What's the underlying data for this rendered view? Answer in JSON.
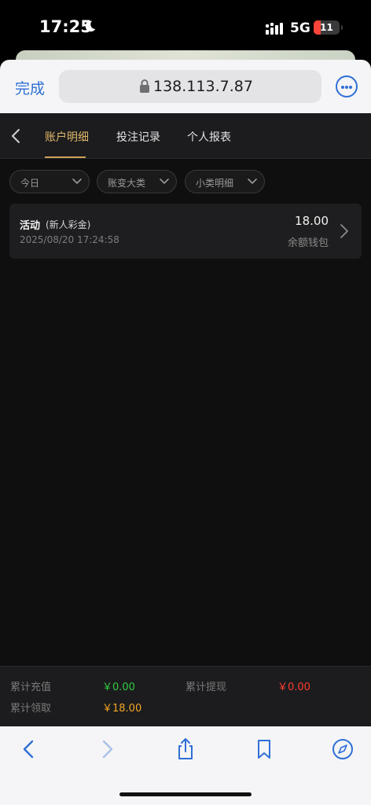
{
  "status_bar": {
    "time": "17:25",
    "network": "5G",
    "battery": "11",
    "icons": [
      "moon-icon",
      "signal-icon",
      "battery-icon"
    ]
  },
  "browser": {
    "done_label": "完成",
    "url": "138.113.7.87",
    "accent_color": "#2f6fd6"
  },
  "header": {
    "tabs": [
      {
        "label": "账户明细",
        "active": true
      },
      {
        "label": "投注记录",
        "active": false
      },
      {
        "label": "个人报表",
        "active": false
      }
    ],
    "accent_color": "#e0b86a"
  },
  "filters": [
    {
      "label": "今日"
    },
    {
      "label": "账变大类"
    },
    {
      "label": "小类明细"
    }
  ],
  "records": [
    {
      "title": "活动",
      "subtitle": "(新人彩金)",
      "time": "2025/08/20 17:24:58",
      "amount": "18.00",
      "wallet": "余额钱包"
    }
  ],
  "totals": {
    "recharge_label": "累计充值",
    "recharge_value": "￥0.00",
    "recharge_color": "#2ecc40",
    "withdraw_label": "累计提现",
    "withdraw_value": "￥0.00",
    "withdraw_color": "#ff3b30",
    "claim_label": "累计领取",
    "claim_value": "￥18.00",
    "claim_color": "#f5a623"
  },
  "toolbar": {
    "icons": [
      "back-arrow-icon",
      "forward-arrow-icon",
      "share-icon",
      "bookmarks-icon",
      "compass-icon"
    ]
  }
}
